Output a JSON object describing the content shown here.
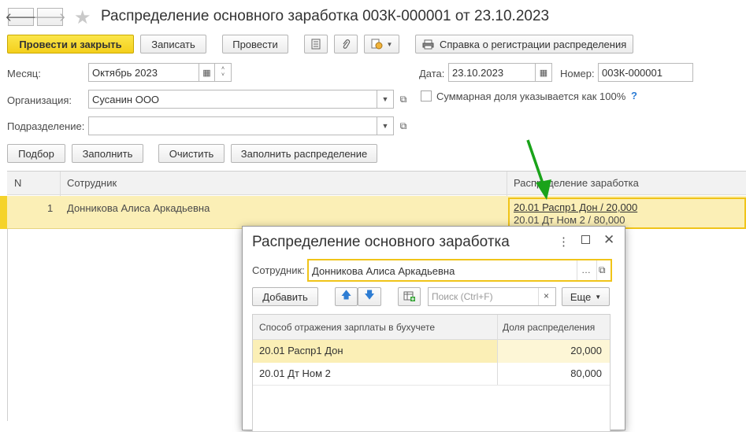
{
  "header": {
    "back_icon": "arrow-left-icon",
    "forward_icon": "arrow-right-icon",
    "favorite_icon": "star-icon",
    "title": "Распределение основного заработка 003К-000001 от 23.10.2023"
  },
  "toolbar": {
    "post_close": "Провести и закрыть",
    "write": "Записать",
    "post": "Провести",
    "report_icon": "document-list-icon",
    "attach_icon": "paperclip-icon",
    "create_based_icon": "create-based-on-icon",
    "print_label": "Справка о регистрации распределения"
  },
  "form": {
    "month_label": "Месяц:",
    "month_value": "Октябрь 2023",
    "date_label": "Дата:",
    "date_value": "23.10.2023",
    "number_label": "Номер:",
    "number_value": "003К-000001",
    "org_label": "Организация:",
    "org_value": "Сусанин ООО",
    "total_share_label": "Суммарная доля указывается как 100%",
    "help": "?",
    "dept_label": "Подразделение:",
    "dept_value": ""
  },
  "actions": {
    "select": "Подбор",
    "fill": "Заполнить",
    "clear": "Очистить",
    "fill_distribution": "Заполнить распределение"
  },
  "table": {
    "columns": [
      "N",
      "Сотрудник",
      "Распределение заработка"
    ],
    "rows": [
      {
        "n": "1",
        "employee": "Донникова Алиса Аркадьевна",
        "dist_line1": "20.01 Распр1 Дон / 20,000",
        "dist_line2": "20.01 Дт Ном 2 / 80,000"
      }
    ]
  },
  "dialog": {
    "title": "Распределение основного заработка",
    "employee_label": "Сотрудник:",
    "employee_value": "Донникова Алиса Аркадьевна",
    "add_button": "Добавить",
    "search_placeholder": "Поиск (Ctrl+F)",
    "more_button": "Еще",
    "columns": [
      "Способ отражения зарплаты в бухучете",
      "Доля распределения"
    ],
    "rows": [
      {
        "method": "20.01 Распр1 Дон",
        "share": "20,000"
      },
      {
        "method": "20.01 Дт Ном 2",
        "share": "80,000"
      }
    ]
  },
  "colors": {
    "accent_yellow": "#f5d32a",
    "selected_row": "#fbefb6",
    "arrow_green": "#1aa31a",
    "help_blue": "#2b7bd4"
  }
}
